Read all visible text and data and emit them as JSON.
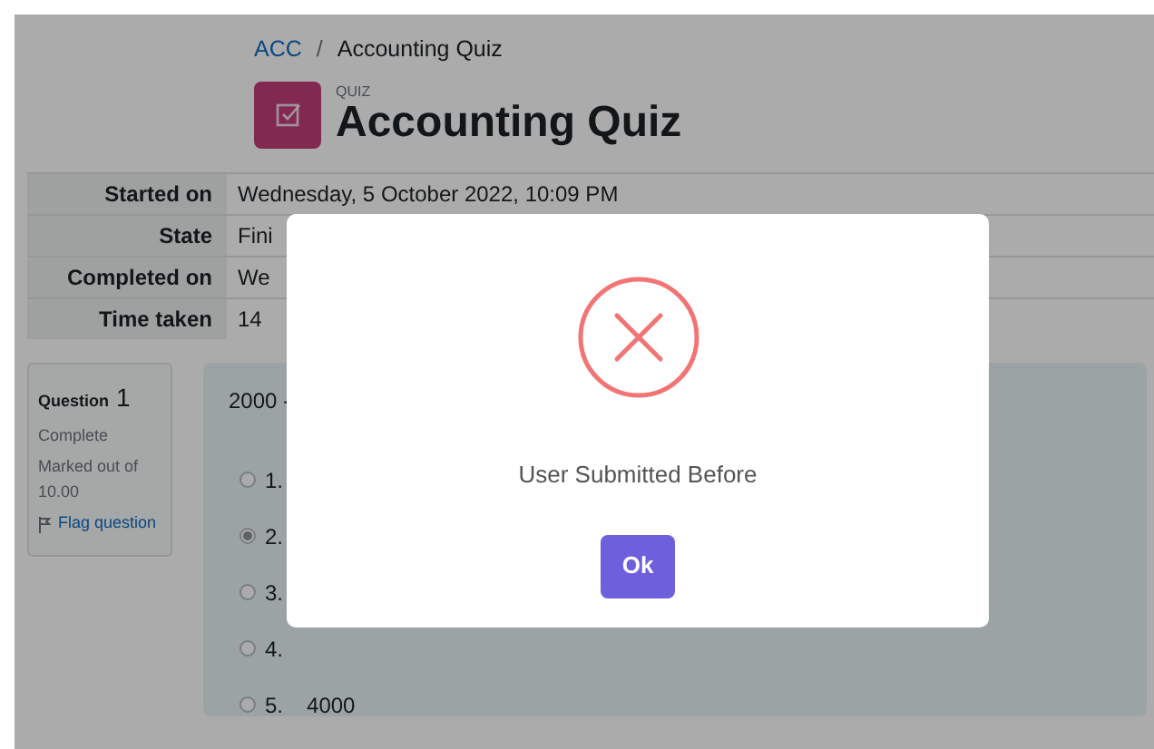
{
  "breadcrumb": {
    "separator": "/",
    "items": [
      {
        "text": "ACC",
        "link": true
      },
      {
        "text": "Accounting Quiz",
        "link": false
      }
    ]
  },
  "header": {
    "kicker": "QUIZ",
    "title": "Accounting Quiz"
  },
  "summary": [
    {
      "label": "Started on",
      "value": "Wednesday, 5 October 2022, 10:09 PM"
    },
    {
      "label": "State",
      "value": "Fini"
    },
    {
      "label": "Completed on",
      "value": "We"
    },
    {
      "label": "Time taken",
      "value": "14"
    }
  ],
  "question_info": {
    "label": "Question",
    "number": "1",
    "status": "Complete",
    "marks": "Marked out of 10.00",
    "flag": "Flag question"
  },
  "question": {
    "text": "2000 -",
    "options": [
      {
        "label": "1.",
        "selected": false
      },
      {
        "label": "2.",
        "selected": true
      },
      {
        "label": "3.",
        "selected": false
      },
      {
        "label": "4.",
        "selected": false
      },
      {
        "label": "5.",
        "text": "4000",
        "selected": false
      }
    ]
  },
  "dialog": {
    "message": "User Submitted Before",
    "button": "Ok"
  }
}
